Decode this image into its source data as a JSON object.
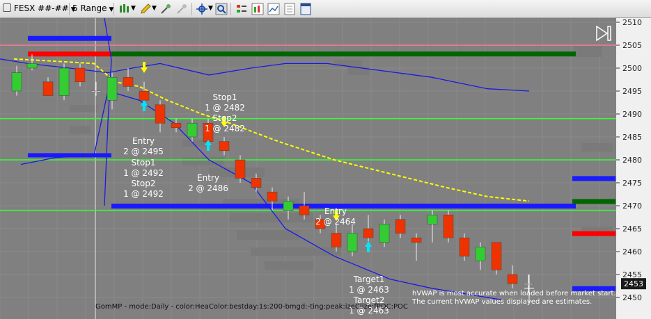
{
  "toolbar": {
    "instrument": "FESX ##-##",
    "bar_type": "5 Range"
  },
  "chart": {
    "price_axis": [
      "2510",
      "2505",
      "2500",
      "2495",
      "2490",
      "2485",
      "2480",
      "2475",
      "2470",
      "2465",
      "2460",
      "2455",
      "2450"
    ],
    "last_price": "2453",
    "footer_status": "GomMP - mode:Daily - color:HeaColor:bestday:1s:200-bmgd:-ting:peak:izeClize:fPOC:POC",
    "hvwap_note_1": "hVWAP is most accurate when loaded before market start.",
    "hvwap_note_2": "The current hVWAP values displayed are estimates."
  },
  "annotations": {
    "entry1_title": "Entry",
    "entry1_value": "2 @ 2495",
    "stop1a_title": "Stop1",
    "stop1a_value": "1 @ 2492",
    "stop2a_title": "Stop2",
    "stop2a_value": "1 @ 2492",
    "stop1b_title": "Stop1",
    "stop1b_value": "1 @ 2482",
    "stop2b_title": "Stop2",
    "stop2b_value": "1 @ 2482",
    "entry2_title": "Entry",
    "entry2_value": "2 @ 2486",
    "entry3_title": "Entry",
    "entry3_value": "2 @ 2464",
    "target1_title": "Target1",
    "target1_value": "1 @ 2463",
    "target2_title": "Target2",
    "target2_value": "1 @ 2463"
  },
  "colors": {
    "up_candle": "#33cc33",
    "down_candle": "#ee3300",
    "vwap_dashed": "#ffff00",
    "blue_band": "#1a1aff",
    "green_level": "#33ff33",
    "dark_green_level": "#006600",
    "red_level": "#ff0000",
    "pink_level": "#ff7799"
  }
}
